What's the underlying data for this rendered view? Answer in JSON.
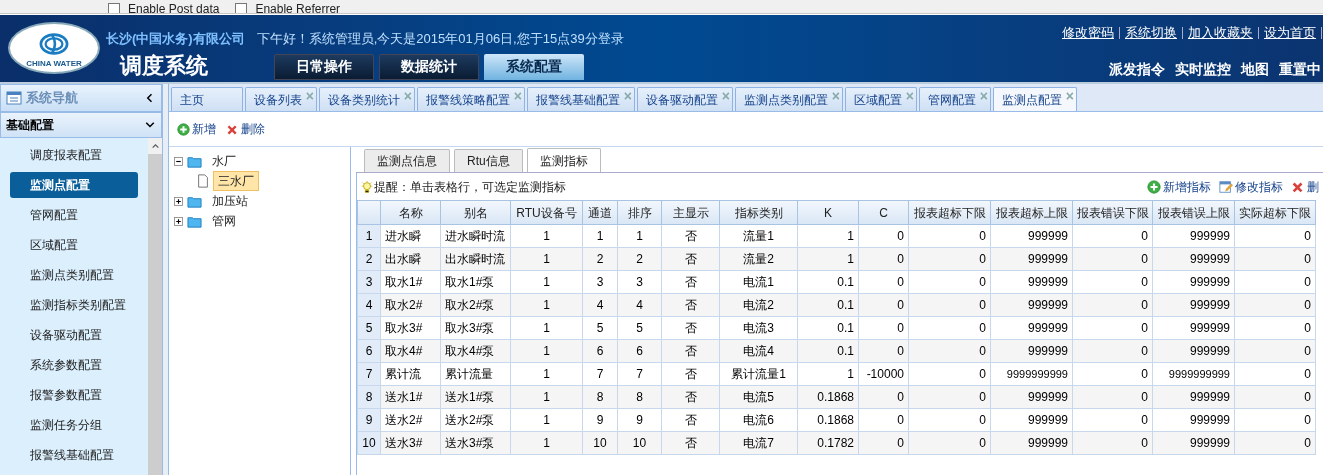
{
  "browser_bar": {
    "options": [
      {
        "label": "Enable Post data",
        "checked": false
      },
      {
        "label": "Enable Referrer",
        "checked": false
      }
    ]
  },
  "header": {
    "company": "长沙(中国水务)有限公司",
    "greeting": "下午好！系统管理员,今天是2015年01月06日,您于15点39分登录",
    "system_name": "调度系统",
    "logo_text": "CHINA WATER",
    "main_tabs": [
      {
        "label": "日常操作",
        "selected": false
      },
      {
        "label": "数据统计",
        "selected": false
      },
      {
        "label": "系统配置",
        "selected": true
      }
    ],
    "links": [
      "修改密码",
      "系统切换",
      "加入收藏夹",
      "设为首页"
    ],
    "quick_nav": [
      "派发指令",
      "实时监控",
      "地图",
      "重置中"
    ]
  },
  "sidebar": {
    "title": "系统导航",
    "section": {
      "label": "基础配置",
      "expanded": true
    },
    "items": [
      {
        "label": "调度报表配置",
        "selected": false
      },
      {
        "label": "监测点配置",
        "selected": true
      },
      {
        "label": "管网配置",
        "selected": false
      },
      {
        "label": "区域配置",
        "selected": false
      },
      {
        "label": "监测点类别配置",
        "selected": false
      },
      {
        "label": "监测指标类别配置",
        "selected": false
      },
      {
        "label": "设备驱动配置",
        "selected": false
      },
      {
        "label": "系统参数配置",
        "selected": false
      },
      {
        "label": "报警参数配置",
        "selected": false
      },
      {
        "label": "监测任务分组",
        "selected": false
      },
      {
        "label": "报警线基础配置",
        "selected": false
      }
    ]
  },
  "page_tabs": [
    {
      "label": "主页",
      "closable": false,
      "selected": false
    },
    {
      "label": "设备列表",
      "closable": true,
      "selected": false
    },
    {
      "label": "设备类别统计",
      "closable": true,
      "selected": false
    },
    {
      "label": "报警线策略配置",
      "closable": true,
      "selected": false
    },
    {
      "label": "报警线基础配置",
      "closable": true,
      "selected": false
    },
    {
      "label": "设备驱动配置",
      "closable": true,
      "selected": false
    },
    {
      "label": "监测点类别配置",
      "closable": true,
      "selected": false
    },
    {
      "label": "区域配置",
      "closable": true,
      "selected": false
    },
    {
      "label": "管网配置",
      "closable": true,
      "selected": false
    },
    {
      "label": "监测点配置",
      "closable": true,
      "selected": true
    }
  ],
  "close_glyph": "×",
  "toolbar": [
    {
      "kind": "add",
      "label": "新增"
    },
    {
      "kind": "delete",
      "label": "删除"
    }
  ],
  "tree": [
    {
      "label": "水厂",
      "expanded": true,
      "children": [
        {
          "label": "三水厂",
          "selected": true
        }
      ]
    },
    {
      "label": "加压站",
      "expanded": false
    },
    {
      "label": "管网",
      "expanded": false
    }
  ],
  "detail_tabs": [
    {
      "label": "监测点信息",
      "selected": false
    },
    {
      "label": "Rtu信息",
      "selected": false
    },
    {
      "label": "监测指标",
      "selected": true
    }
  ],
  "hint": "提醒：单击表格行，可选定监测指标",
  "actions": [
    {
      "kind": "add",
      "label": "新增指标"
    },
    {
      "kind": "edit",
      "label": "修改指标"
    },
    {
      "kind": "delete",
      "label": "删"
    }
  ],
  "table": {
    "columns": [
      "",
      "名称",
      "别名",
      "RTU设备号",
      "通道",
      "排序",
      "主显示",
      "指标类别",
      "K",
      "C",
      "报表超标下限",
      "报表超标上限",
      "报表错误下限",
      "报表错误上限",
      "实际超标下限"
    ],
    "rows": [
      [
        "1",
        "进水瞬",
        "进水瞬时流",
        "1",
        "1",
        "1",
        "否",
        "流量1",
        "1",
        "0",
        "0",
        "999999",
        "0",
        "999999",
        "0"
      ],
      [
        "2",
        "出水瞬",
        "出水瞬时流",
        "1",
        "2",
        "2",
        "否",
        "流量2",
        "1",
        "0",
        "0",
        "999999",
        "0",
        "999999",
        "0"
      ],
      [
        "3",
        "取水1#",
        "取水1#泵",
        "1",
        "3",
        "3",
        "否",
        "电流1",
        "0.1",
        "0",
        "0",
        "999999",
        "0",
        "999999",
        "0"
      ],
      [
        "4",
        "取水2#",
        "取水2#泵",
        "1",
        "4",
        "4",
        "否",
        "电流2",
        "0.1",
        "0",
        "0",
        "999999",
        "0",
        "999999",
        "0"
      ],
      [
        "5",
        "取水3#",
        "取水3#泵",
        "1",
        "5",
        "5",
        "否",
        "电流3",
        "0.1",
        "0",
        "0",
        "999999",
        "0",
        "999999",
        "0"
      ],
      [
        "6",
        "取水4#",
        "取水4#泵",
        "1",
        "6",
        "6",
        "否",
        "电流4",
        "0.1",
        "0",
        "0",
        "999999",
        "0",
        "999999",
        "0"
      ],
      [
        "7",
        "累计流",
        "累计流量",
        "1",
        "7",
        "7",
        "否",
        "累计流量1",
        "1",
        "-10000",
        "0",
        "9999999999",
        "0",
        "9999999999",
        "0"
      ],
      [
        "8",
        "送水1#",
        "送水1#泵",
        "1",
        "8",
        "8",
        "否",
        "电流5",
        "0.1868",
        "0",
        "0",
        "999999",
        "0",
        "999999",
        "0"
      ],
      [
        "9",
        "送水2#",
        "送水2#泵",
        "1",
        "9",
        "9",
        "否",
        "电流6",
        "0.1868",
        "0",
        "0",
        "999999",
        "0",
        "999999",
        "0"
      ],
      [
        "10",
        "送水3#",
        "送水3#泵",
        "1",
        "10",
        "10",
        "否",
        "电流7",
        "0.1782",
        "0",
        "0",
        "999999",
        "0",
        "999999",
        "0"
      ]
    ]
  }
}
